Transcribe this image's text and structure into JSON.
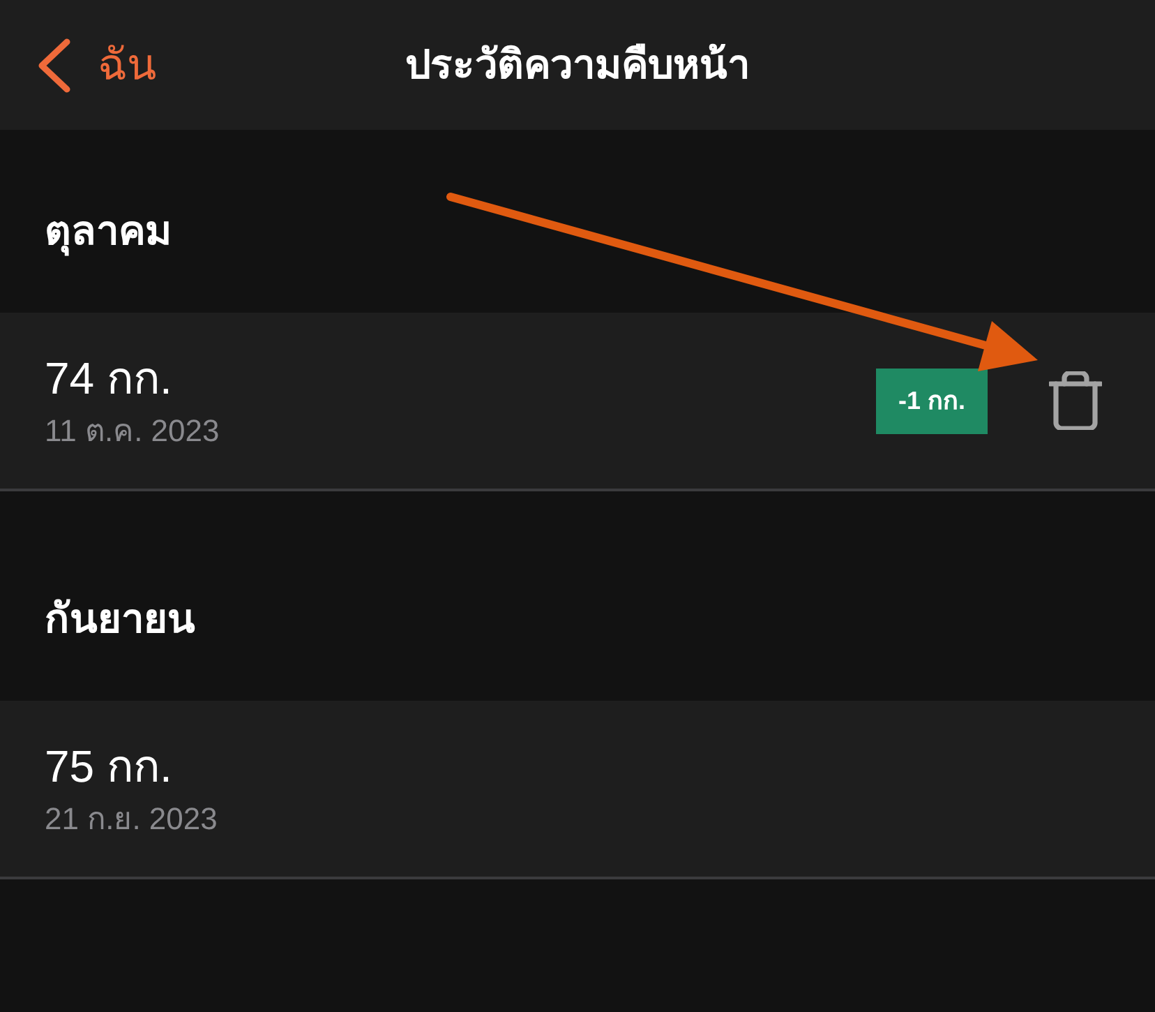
{
  "nav": {
    "back_label": "ฉัน",
    "title": "ประวัติความคืบหน้า"
  },
  "sections": [
    {
      "title": "ตุลาคม",
      "entries": [
        {
          "weight": "74 กก.",
          "date": "11 ต.ค. 2023",
          "change": "-1 กก.",
          "deletable": true
        }
      ]
    },
    {
      "title": "กันยายน",
      "entries": [
        {
          "weight": "75 กก.",
          "date": "21 ก.ย. 2023",
          "deletable": false
        }
      ]
    }
  ]
}
